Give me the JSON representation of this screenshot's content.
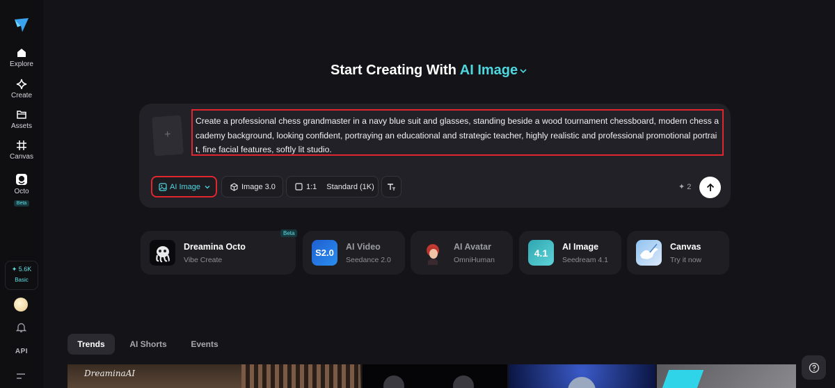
{
  "sidebar": {
    "items": [
      {
        "label": "Explore",
        "icon": "home-icon"
      },
      {
        "label": "Create",
        "icon": "sparkle-icon"
      },
      {
        "label": "Assets",
        "icon": "folder-icon"
      },
      {
        "label": "Canvas",
        "icon": "canvas-icon"
      },
      {
        "label": "Octo",
        "icon": "octo-icon",
        "badge": "Beta"
      }
    ],
    "credits": {
      "amount": "✦ 5.6K",
      "plan": "Basic"
    },
    "api_label": "API"
  },
  "headline": {
    "prefix": "Start Creating With",
    "accent": "AI Image"
  },
  "prompt": {
    "ref_plus": "+",
    "text": "Create a professional chess grandmaster in a navy blue suit and glasses, standing beside a wood tournament chessboard, modern chess academy background, looking confident, portraying an educational and strategic teacher, highly realistic and professional promotional portrait, fine facial features, softly lit studio."
  },
  "toolbar": {
    "mode_label": "AI Image",
    "model_label": "Image 3.0",
    "ratio_label": "1:1",
    "quality_label": "Standard (1K)",
    "cost": "✦ 2"
  },
  "tools": [
    {
      "name": "Dreamina Octo",
      "sub": "Vibe Create",
      "badge": "Beta"
    },
    {
      "name": "AI Video",
      "sub": "Seedance 2.0",
      "icon_text": "S2.0"
    },
    {
      "name": "AI Avatar",
      "sub": "OmniHuman"
    },
    {
      "name": "AI Image",
      "sub": "Seedream 4.1",
      "icon_text": "4.1"
    },
    {
      "name": "Canvas",
      "sub": "Try it now"
    }
  ],
  "tabs": [
    {
      "label": "Trends",
      "active": true
    },
    {
      "label": "AI Shorts",
      "active": false
    },
    {
      "label": "Events",
      "active": false
    }
  ],
  "gallery": {
    "first_item_watermark": "DreaminaAI"
  },
  "colors": {
    "accent": "#4fd7e0",
    "highlight_border": "#e0262f",
    "background": "#141418"
  }
}
